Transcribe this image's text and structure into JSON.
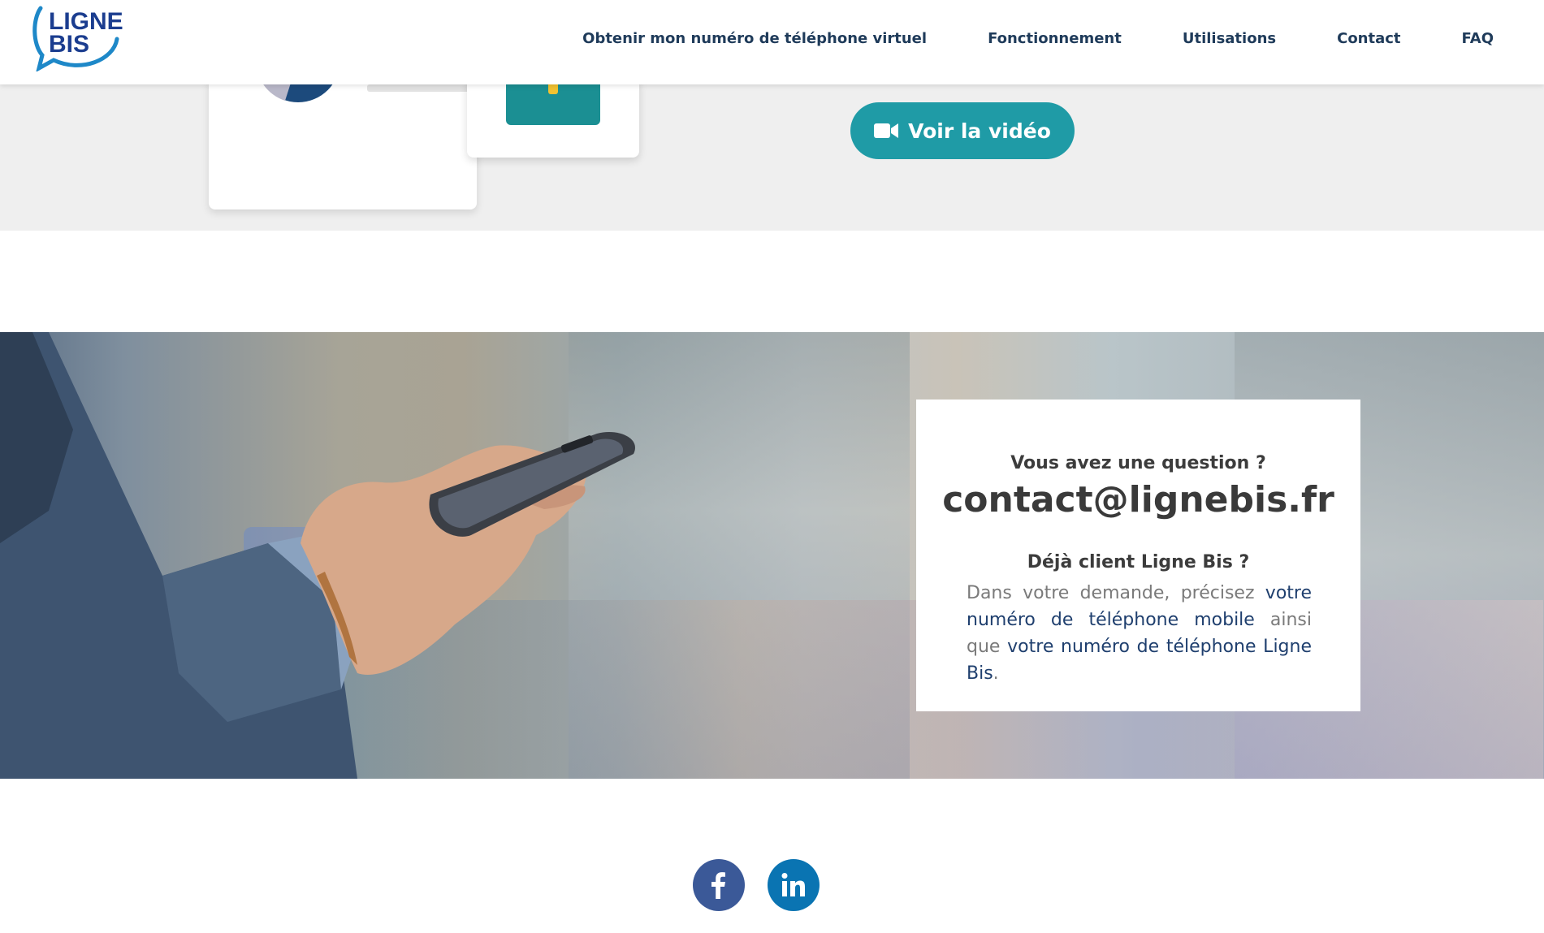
{
  "header": {
    "logo_text_line1": "LIGNE",
    "logo_text_line2": "BIS",
    "nav": [
      {
        "label": "Obtenir mon numéro de téléphone virtuel"
      },
      {
        "label": "Fonctionnement"
      },
      {
        "label": "Utilisations"
      },
      {
        "label": "Contact"
      },
      {
        "label": "FAQ"
      }
    ]
  },
  "hero": {
    "video_button_label": "Voir la vidéo",
    "video_icon": "video-camera-icon"
  },
  "contact": {
    "question_title": "Vous avez une question ?",
    "email": "contact@lignebis.fr",
    "client_title": "Déjà client Ligne Bis ?",
    "text_part1": "Dans votre demande, précisez ",
    "text_link1": "votre numéro de téléphone mobile",
    "text_part2": " ainsi que ",
    "text_link2": "votre numéro de téléphone Ligne Bis",
    "text_part3": "."
  },
  "social": [
    {
      "icon": "facebook-icon",
      "color": "#3b5998"
    },
    {
      "icon": "linkedin-icon",
      "color": "#0a74b2"
    }
  ],
  "colors": {
    "accent": "#1f9ba6",
    "nav_text": "#1f3b5a",
    "link_blue": "#1f3f6e",
    "logo_blue": "#1e88c8"
  }
}
